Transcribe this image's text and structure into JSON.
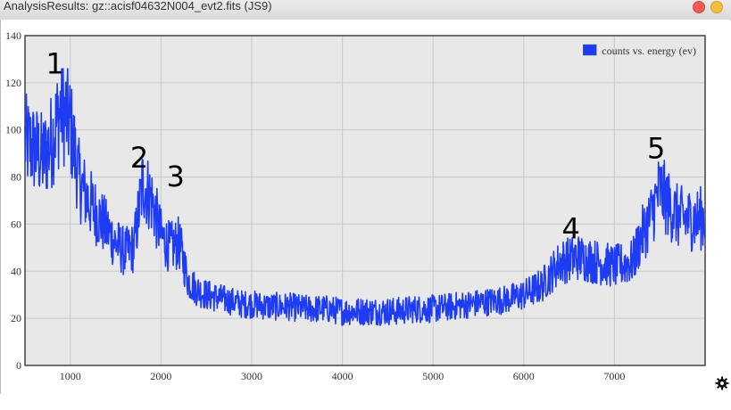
{
  "window": {
    "title": "AnalysisResults: gz::acisf04632N004_evt2.fits (JS9)"
  },
  "colors": {
    "series": "#1f3cf5",
    "plot_bg": "#e8e8e8",
    "grid": "#c9c9c9",
    "close": "#f35c55",
    "minimize": "#f7bd3c"
  },
  "icons": {
    "settings": "gear-icon",
    "close": "close-icon",
    "minimize": "minimize-icon"
  },
  "chart_data": {
    "type": "line",
    "xlim": [
      500,
      8000
    ],
    "ylim": [
      0,
      140
    ],
    "xticks": [
      1000,
      2000,
      3000,
      4000,
      5000,
      6000,
      7000
    ],
    "yticks": [
      0,
      20,
      40,
      60,
      80,
      100,
      120,
      140
    ],
    "grid": true,
    "legend_position": "top-right",
    "series": [
      {
        "name": "counts vs. energy (ev)",
        "color": "#1f3cf5",
        "x": [
          500,
          600,
          700,
          800,
          900,
          1000,
          1100,
          1200,
          1300,
          1400,
          1500,
          1600,
          1700,
          1800,
          1900,
          2000,
          2100,
          2200,
          2300,
          2400,
          2500,
          2600,
          2700,
          2800,
          2900,
          3000,
          3200,
          3400,
          3600,
          3800,
          4000,
          4200,
          4400,
          4600,
          4800,
          5000,
          5200,
          5400,
          5600,
          5800,
          6000,
          6200,
          6400,
          6600,
          6800,
          7000,
          7200,
          7300,
          7400,
          7500,
          7600,
          7700,
          7800,
          7900,
          8000
        ],
        "y": [
          95,
          92,
          88,
          96,
          110,
          102,
          78,
          70,
          64,
          58,
          52,
          48,
          50,
          78,
          70,
          55,
          50,
          52,
          36,
          32,
          30,
          29,
          28,
          27,
          26,
          26,
          25,
          25,
          24,
          24,
          23,
          23,
          23,
          23,
          24,
          24,
          25,
          26,
          27,
          28,
          30,
          34,
          44,
          46,
          44,
          42,
          44,
          55,
          63,
          75,
          68,
          63,
          62,
          62,
          63
        ]
      }
    ],
    "annotations": [
      {
        "text": "1",
        "x": 830,
        "y": 124
      },
      {
        "text": "2",
        "x": 1760,
        "y": 84
      },
      {
        "text": "3",
        "x": 2160,
        "y": 76
      },
      {
        "text": "4",
        "x": 6520,
        "y": 54
      },
      {
        "text": "5",
        "x": 7460,
        "y": 88
      }
    ]
  }
}
